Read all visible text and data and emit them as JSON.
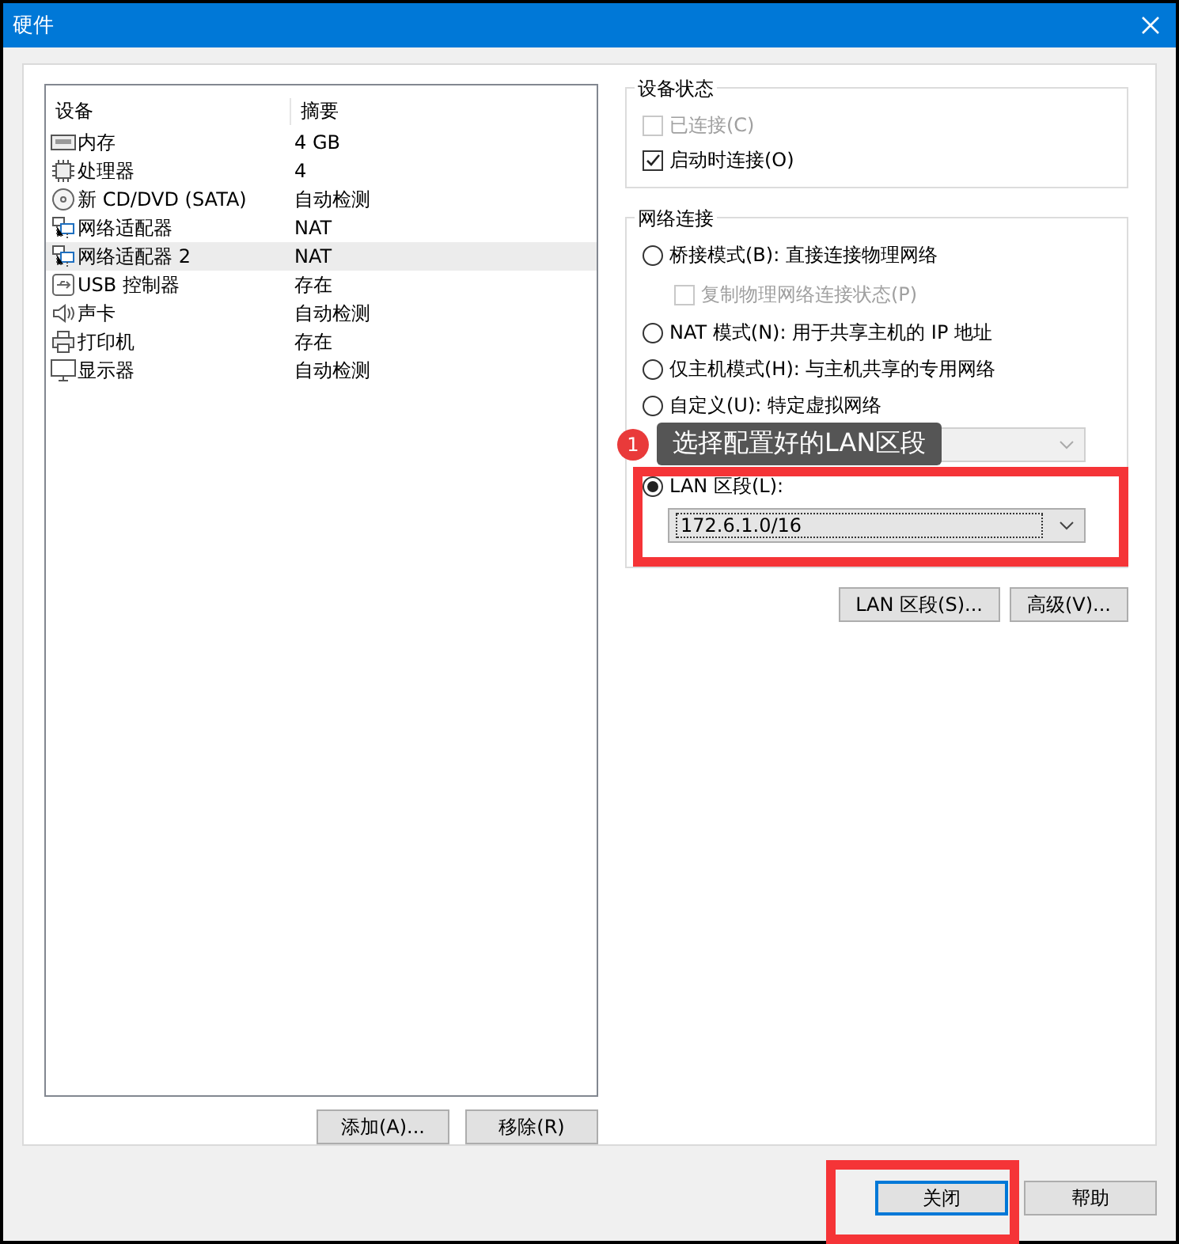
{
  "window": {
    "title": "硬件"
  },
  "devices": {
    "columns": [
      "设备",
      "摘要"
    ],
    "rows": [
      {
        "kind": "memory",
        "name": "内存",
        "summary": "4 GB",
        "selected": false
      },
      {
        "kind": "cpu",
        "name": "处理器",
        "summary": "4",
        "selected": false
      },
      {
        "kind": "disc",
        "name": "新 CD/DVD (SATA)",
        "summary": "自动检测",
        "selected": false
      },
      {
        "kind": "network",
        "name": "网络适配器",
        "summary": "NAT",
        "selected": false
      },
      {
        "kind": "network",
        "name": "网络适配器 2",
        "summary": "NAT",
        "selected": true
      },
      {
        "kind": "usb",
        "name": "USB 控制器",
        "summary": "存在",
        "selected": false
      },
      {
        "kind": "sound",
        "name": "声卡",
        "summary": "自动检测",
        "selected": false
      },
      {
        "kind": "printer",
        "name": "打印机",
        "summary": "存在",
        "selected": false
      },
      {
        "kind": "display",
        "name": "显示器",
        "summary": "自动检测",
        "selected": false
      }
    ]
  },
  "list_buttons": [
    "添加(A)...",
    "移除(R)"
  ],
  "device_status": {
    "title": "设备状态",
    "options": [
      {
        "label": "已连接(C)",
        "checked": false,
        "disabled": true
      },
      {
        "label": "启动时连接(O)",
        "checked": true,
        "disabled": false
      }
    ]
  },
  "network": {
    "title": "网络连接",
    "items": [
      {
        "kind": "radio",
        "label": "桥接模式(B): 直接连接物理网络",
        "selected": false
      },
      {
        "kind": "checkbox",
        "label": "复制物理网络连接状态(P)",
        "checked": false,
        "disabled": true
      },
      {
        "kind": "radio",
        "label": "NAT 模式(N): 用于共享主机的 IP 地址",
        "selected": false
      },
      {
        "kind": "radio",
        "label": "仅主机模式(H): 与主机共享的专用网络",
        "selected": false
      },
      {
        "kind": "radio",
        "label": "自定义(U): 特定虚拟网络",
        "selected": false
      },
      {
        "kind": "select",
        "disabled": true
      },
      {
        "kind": "radio",
        "label": "LAN 区段(L):",
        "selected": true
      },
      {
        "kind": "select",
        "value": "172.6.1.0/16",
        "disabled": false
      }
    ]
  },
  "network_buttons": [
    "LAN 区段(S)...",
    "高级(V)..."
  ],
  "callout": {
    "number": "1",
    "text": "选择配置好的LAN区段"
  },
  "dialog_buttons": [
    {
      "label": "关闭",
      "focused": true
    },
    {
      "label": "帮助",
      "focused": false
    }
  ]
}
